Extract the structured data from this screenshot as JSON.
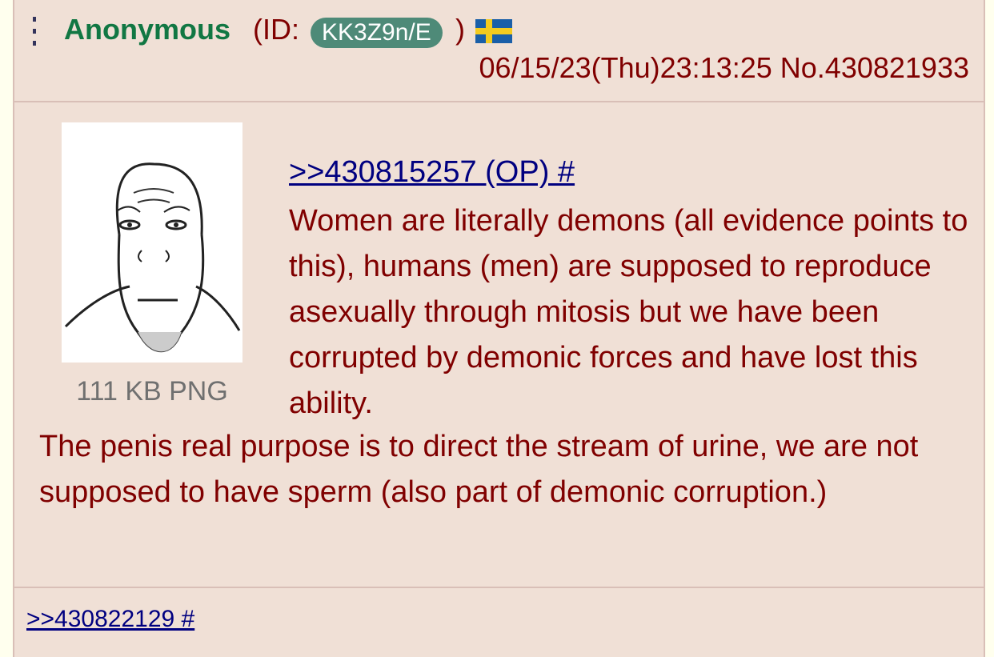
{
  "post": {
    "name": "Anonymous",
    "id_prefix": "(ID:",
    "poster_id": "KK3Z9n/E",
    "id_suffix": ")",
    "flag_icon": "sweden-flag-icon",
    "datetime": "06/15/23(Thu)23:13:25",
    "post_number": "No.430821933",
    "file_info": "111 KB PNG",
    "quote_link": ">>430815257 (OP) #",
    "text_beside_image": "Women are literally demons (all evidence points to this), humans (men) are supposed to reproduce asexually through mitosis but we have been corrupted by demonic forces and have lost this ability.",
    "text_below_image": "The penis real purpose is to direct the stream of urine, we are not supposed to have sperm (also part of demonic corruption.)",
    "reply_link": ">>430822129 #"
  },
  "colors": {
    "name": "#117743",
    "post_bg": "#f0e0d6",
    "text": "#800000",
    "link": "#000080",
    "id_pill": "#4e8a78"
  }
}
